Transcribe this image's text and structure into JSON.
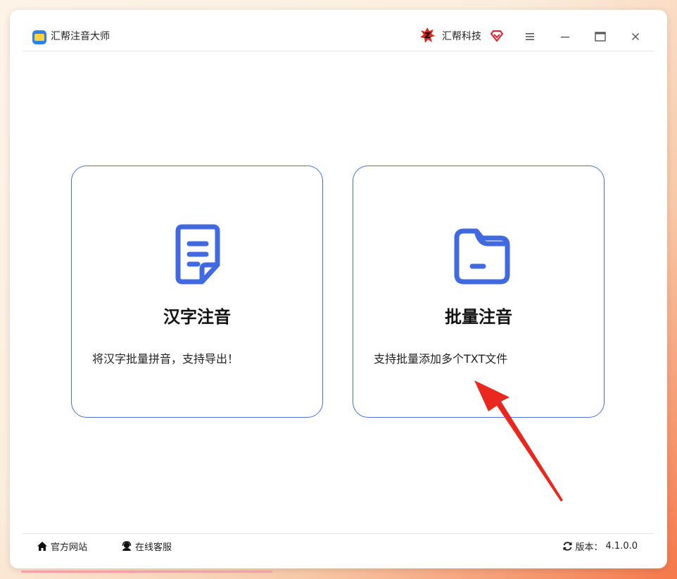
{
  "titlebar": {
    "app_title": "汇帮注音大师",
    "brand_name": "汇帮科技",
    "icons": {
      "app_logo": "app-logo-icon",
      "brand_logo": "brand-logo-icon",
      "vip": "diamond-vip-icon",
      "menu": "menu-icon",
      "minimize": "minimize-icon",
      "maximize": "maximize-icon",
      "close": "close-icon"
    }
  },
  "cards": [
    {
      "title": "汉字注音",
      "description": "将汉字批量拼音，支持导出！",
      "icon": "document-icon"
    },
    {
      "title": "批量注音",
      "description": "支持批量添加多个TXT文件",
      "icon": "folder-icon"
    }
  ],
  "footer": {
    "site_label": "官方网站",
    "service_label": "在线客服",
    "version_label": "版本：",
    "version_value": "4.1.0.0",
    "icons": {
      "site": "home-icon",
      "service": "headset-icon",
      "version": "refresh-icon"
    }
  },
  "colors": {
    "accent": "#4a6fdc",
    "icon_blue": "#4169e1",
    "annotation_arrow": "#e8281e",
    "vip_red": "#e02030"
  }
}
